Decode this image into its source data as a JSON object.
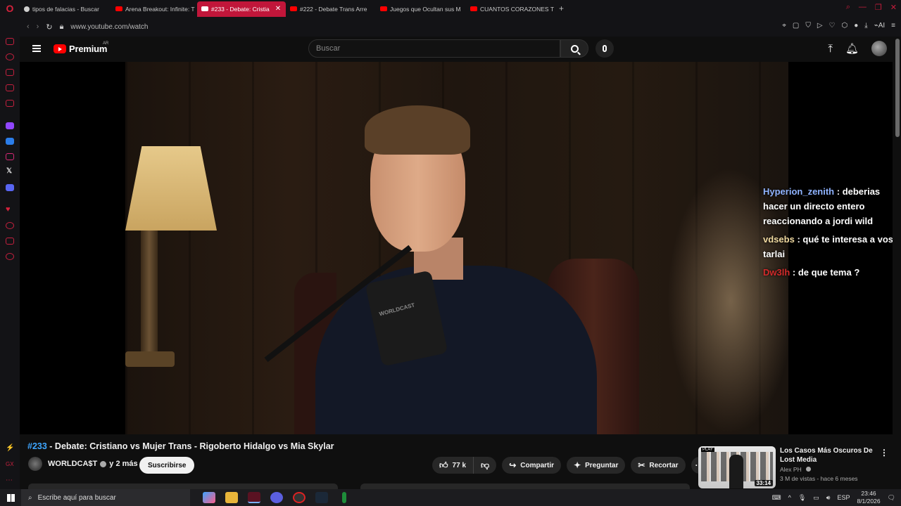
{
  "browser": {
    "tabs": [
      {
        "label": "tipos de falacias - Buscar",
        "favicon": "search-favicon"
      },
      {
        "label": "Arena Breakout: Infinite: T",
        "favicon": "youtube-favicon"
      },
      {
        "label": "#233 - Debate: Cristia",
        "favicon": "youtube-favicon",
        "active": true
      },
      {
        "label": "#222 - Debate Trans Arre",
        "favicon": "youtube-favicon"
      },
      {
        "label": "Juegos que Ocultan sus M",
        "favicon": "youtube-favicon"
      },
      {
        "label": "CUANTOS CORAZONES T",
        "favicon": "youtube-favicon"
      }
    ],
    "url": "www.youtube.com/watch",
    "accent": "#c1163a"
  },
  "youtube": {
    "logo_text": "Premium",
    "country": "AR",
    "search_placeholder": "Buscar"
  },
  "video": {
    "hash": "#233",
    "title": " - Debate: Cristiano vs Mujer Trans - Rigoberto Hidalgo vs Mia Skylar",
    "mic_label": "WORLDCAST",
    "channel": "WORLDCA$T",
    "channel_more": "y 2 más",
    "subscribe_label": "Suscribirse",
    "likes": "77 k",
    "share_label": "Compartir",
    "ask_label": "Preguntar",
    "clip_label": "Recortar"
  },
  "chat": [
    {
      "user": "Hyperion_zenith",
      "text": ": deberias hacer un directo entero reaccionando a jordi wild",
      "color": "#8fb3ff"
    },
    {
      "user": "vdsebs",
      "text": ": qué te interesa a vos tarlai",
      "color": "#f0d9a0"
    },
    {
      "user": "Dw3lh",
      "text": ": de que tema ?",
      "color": "#d12a2a"
    }
  ],
  "recommended": {
    "play_tag": "PLAY",
    "title": "Los Casos Más Oscuros De Lost Media",
    "channel": "Alex PH",
    "meta": "3 M de vistas - hace 6 meses",
    "duration": "33:14"
  },
  "taskbar": {
    "search_placeholder": "Escribe aquí para buscar",
    "lang": "ESP",
    "time": "23:46",
    "date": "8/1/2026"
  }
}
